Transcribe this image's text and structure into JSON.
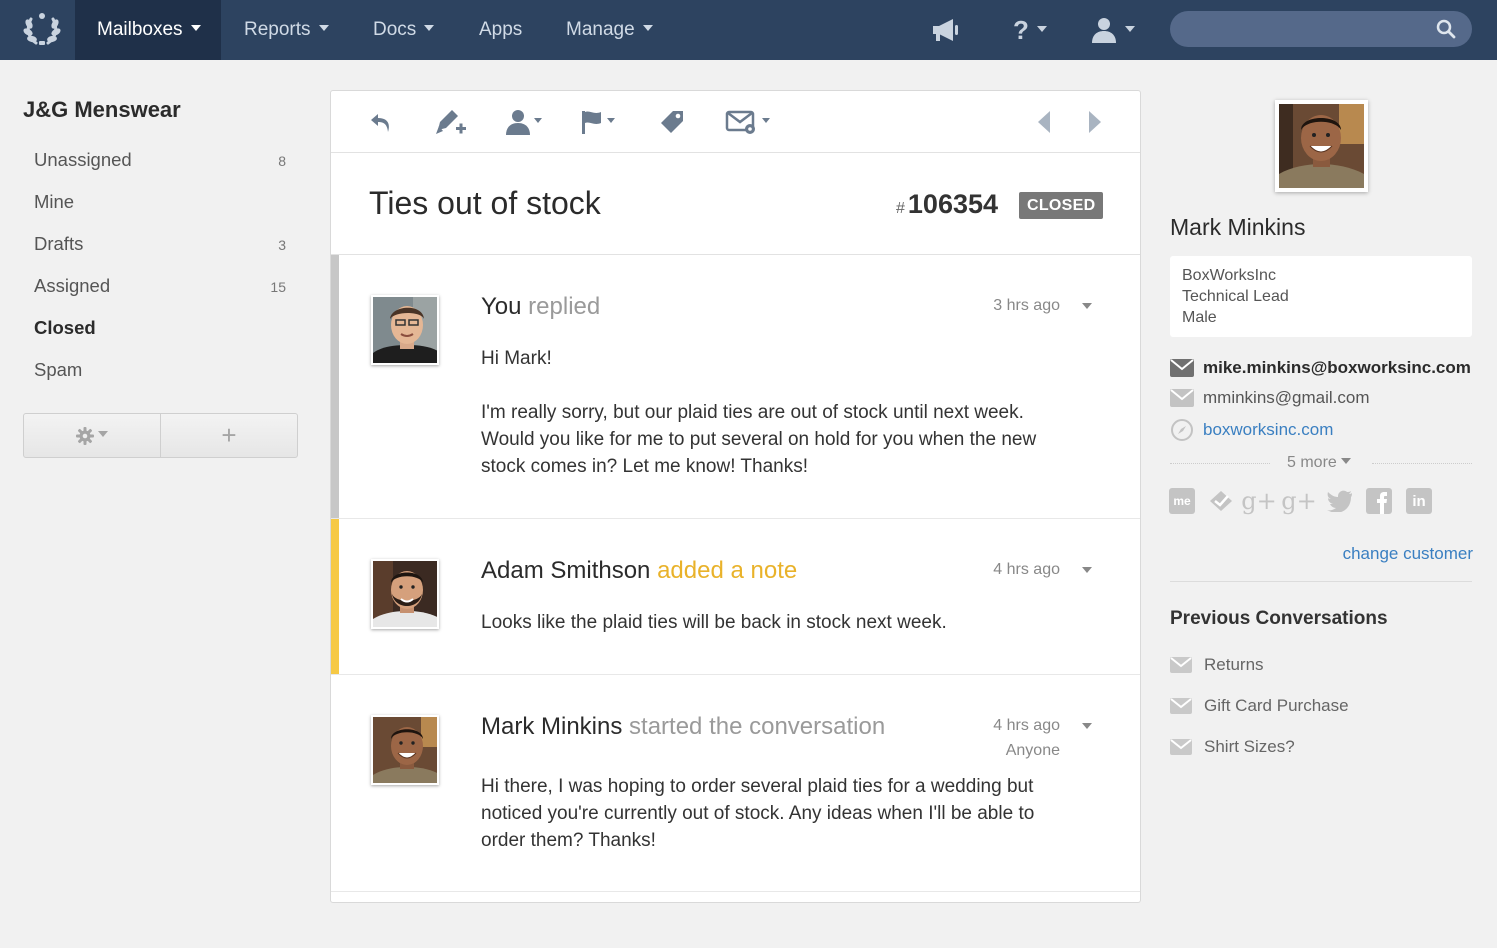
{
  "nav": {
    "items": [
      {
        "label": "Mailboxes",
        "active": true,
        "dropdown": true
      },
      {
        "label": "Reports",
        "active": false,
        "dropdown": true
      },
      {
        "label": "Docs",
        "active": false,
        "dropdown": true
      },
      {
        "label": "Apps",
        "active": false,
        "dropdown": false
      },
      {
        "label": "Manage",
        "active": false,
        "dropdown": true
      }
    ],
    "icons": [
      "laurel-logo-icon",
      "megaphone-icon",
      "help-icon",
      "user-icon"
    ],
    "help_label": "?",
    "search_placeholder": ""
  },
  "sidebar": {
    "mailbox_name": "J&G Menswear",
    "folders": [
      {
        "label": "Unassigned",
        "count": "8",
        "active": false
      },
      {
        "label": "Mine",
        "count": "",
        "active": false
      },
      {
        "label": "Drafts",
        "count": "3",
        "active": false
      },
      {
        "label": "Assigned",
        "count": "15",
        "active": false
      },
      {
        "label": "Closed",
        "count": "",
        "active": true
      },
      {
        "label": "Spam",
        "count": "",
        "active": false
      }
    ],
    "settings_icon": "gear-icon",
    "add_icon": "plus-icon",
    "add_label": "+"
  },
  "toolbar": {
    "icons": [
      "reply-icon",
      "note-icon",
      "assign-icon",
      "flag-icon",
      "tag-icon",
      "email-settings-icon",
      "prev-arrow-icon",
      "next-arrow-icon"
    ]
  },
  "conversation": {
    "subject": "Ties out of stock",
    "hash": "#",
    "number": "106354",
    "status": "CLOSED",
    "threads": [
      {
        "name": "You",
        "action": "replied",
        "time": "3 hrs ago",
        "bar_color": "#c7c7c7",
        "body": [
          "Hi Mark!",
          "I'm really sorry, but our plaid ties are out of stock until next week. Would you like for me to put several on hold for you when the new stock comes in? Let me know! Thanks!"
        ]
      },
      {
        "name": "Adam Smithson",
        "action": "added a note",
        "time": "4 hrs ago",
        "bar_color": "#f6c945",
        "body": [
          "Looks like the plaid ties will be back in stock next week."
        ]
      },
      {
        "name": "Mark Minkins",
        "action": "started the conversation",
        "time": "4 hrs ago",
        "sub_time": "Anyone",
        "bar_color": "",
        "body": [
          "Hi there, I was hoping to order several plaid ties for a wedding but noticed you're currently out of stock. Any ideas when I'll be able to order them? Thanks!"
        ]
      }
    ]
  },
  "customer": {
    "name": "Mark Minkins",
    "company": "BoxWorksInc",
    "title": "Technical Lead",
    "gender": "Male",
    "primary_email": "mike.minkins@boxworksinc.com",
    "secondary_email": "mminkins@gmail.com",
    "website": "boxworksinc.com",
    "more_label": "5 more",
    "social_icons": [
      "aboutme-icon",
      "klout-icon",
      "google-plus-icon",
      "google-plus-alt-icon",
      "twitter-icon",
      "facebook-icon",
      "linkedin-icon"
    ],
    "social_labels": {
      "aboutme": "me",
      "gplus": "g+",
      "linkedin": "in"
    },
    "change_label": "change customer"
  },
  "previous": {
    "title": "Previous Conversations",
    "items": [
      "Returns",
      "Gift Card Purchase",
      "Shirt Sizes?"
    ]
  },
  "colors": {
    "topbar": "#2d4360",
    "topbar_active": "#1f3049",
    "note_accent": "#e9b22a",
    "link": "#3a7fc1",
    "status_badge": "#787878"
  }
}
